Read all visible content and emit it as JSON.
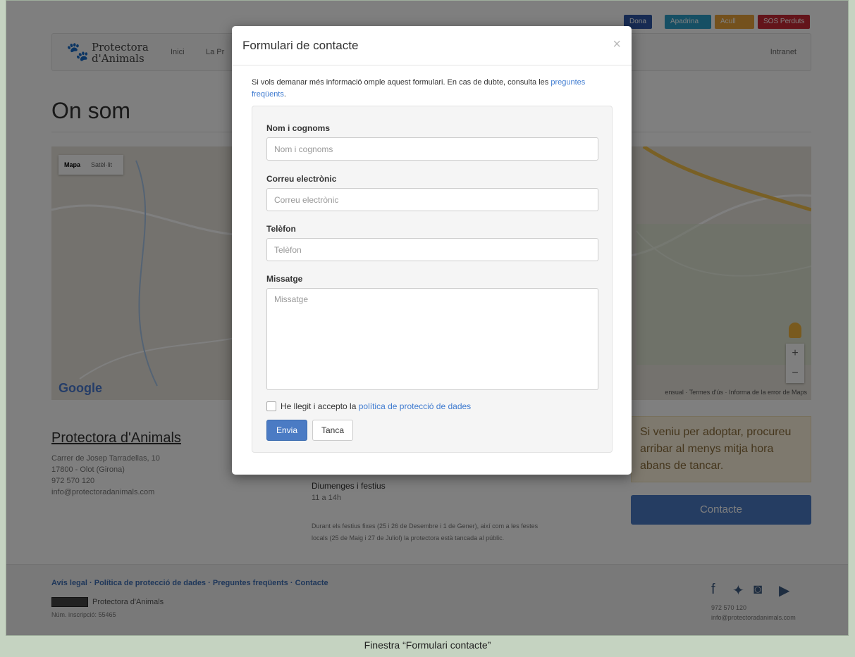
{
  "badges": [
    "Dona",
    "Apadrina",
    "Acull",
    "SOS Perduts"
  ],
  "nav": {
    "logo_line1": "Protectora",
    "logo_line2": "d'Animals",
    "inici": "Inici",
    "second": "La Pr",
    "intranet": "Intranet"
  },
  "page": {
    "title": "On som"
  },
  "map": {
    "tab_map": "Mapa",
    "tab_sat": "Satèl·lit",
    "google": "Google",
    "terms": "ensual · Termes d'ús · Informa de la error de Maps"
  },
  "address": {
    "org": "Protectora d'Animals",
    "line1": "Carrer de Josep Tarradellas, 10",
    "line2": "17800 - Olot (Girona)",
    "phone": "972 570 120",
    "email": "info@protectoradanimals.com"
  },
  "hours": {
    "heading": "Diumenges i festius",
    "value": "11 a 14h",
    "note": "Durant els festius fixes (25 i 26 de Desembre i 1 de Gener), així com a les festes locals (25 de Maig i 27 de Juliol) la protectora està tancada al públic."
  },
  "adopt": "Si veniu per adoptar, procureu arribar al menys mitja hora abans de tancar.",
  "contact_button": "Contacte",
  "footer": {
    "links": "Avís legal · Política de protecció de dades · Preguntes freqüents · Contacte",
    "org": "Protectora d'Animals",
    "reg": "Núm. inscripció: 55465",
    "phone": "972 570 120",
    "email": "info@protectoradanimals.com"
  },
  "modal": {
    "title": "Formulari de contacte",
    "close": "×",
    "intro_text": "Si vols demanar més informació omple aquest formulari. En cas de dubte, consulta les ",
    "intro_link": "preguntes freqüents",
    "intro_end": ".",
    "name_label": "Nom i cognoms",
    "name_placeholder": "Nom i cognoms",
    "email_label": "Correu electrònic",
    "email_placeholder": "Correu electrònic",
    "phone_label": "Telèfon",
    "phone_placeholder": "Telèfon",
    "message_label": "Missatge",
    "message_placeholder": "Missatge",
    "consent_text": "He llegit i accepto la ",
    "consent_link": "política de protecció de dades",
    "send": "Envia",
    "close_button": "Tanca"
  },
  "caption": "Finestra “Formulari contacte”"
}
